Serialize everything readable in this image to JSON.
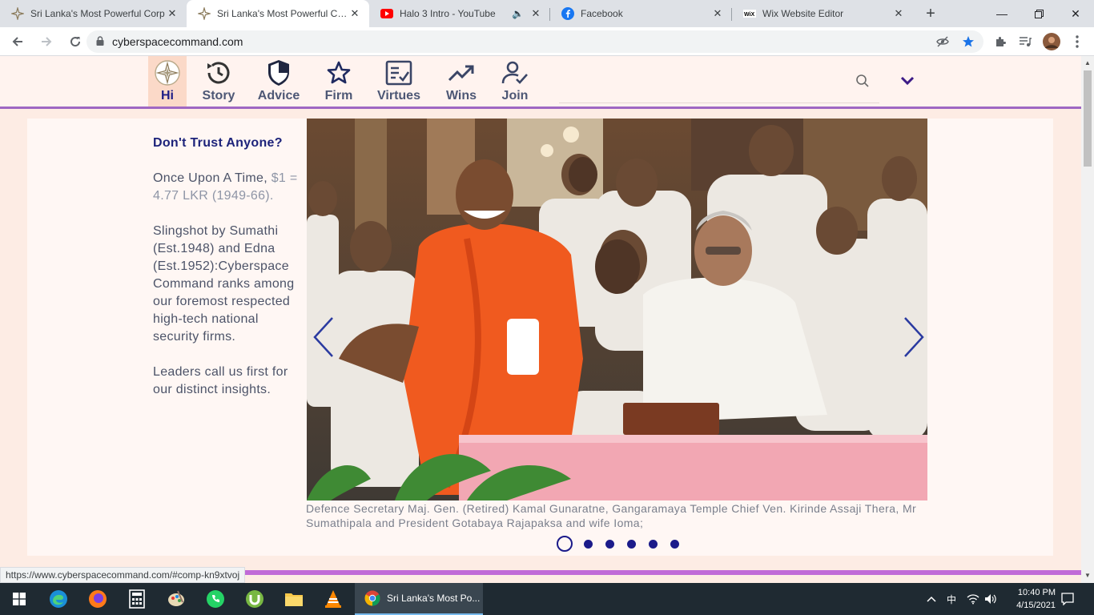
{
  "browser": {
    "tabs": [
      {
        "title": "Sri Lanka's Most Powerful Corp",
        "favicon": "compass-star-icon",
        "active": false
      },
      {
        "title": "Sri Lanka's Most Powerful Corp",
        "favicon": "compass-star-icon",
        "active": true
      },
      {
        "title": "Halo 3 Intro - YouTube",
        "favicon": "youtube-icon",
        "active": false,
        "audio": true
      },
      {
        "title": "Facebook",
        "favicon": "facebook-icon",
        "active": false
      },
      {
        "title": "Wix Website Editor",
        "favicon": "wix-icon",
        "active": false
      }
    ],
    "url": "cyberspacecommand.com",
    "status_url": "https://www.cyberspacecommand.com/#comp-kn9xtvoj"
  },
  "site": {
    "nav": [
      {
        "label": "Hi",
        "icon": "logo-star-icon",
        "active": true
      },
      {
        "label": "Story",
        "icon": "history-icon"
      },
      {
        "label": "Advice",
        "icon": "shield-icon"
      },
      {
        "label": "Firm",
        "icon": "star-outline-icon"
      },
      {
        "label": "Virtues",
        "icon": "checklist-icon"
      },
      {
        "label": "Wins",
        "icon": "trend-up-icon"
      },
      {
        "label": "Join",
        "icon": "user-check-icon"
      }
    ],
    "side": {
      "heading": "Don't Trust Anyone?",
      "para1_text": "Once Upon A Time, ",
      "para1_grey": "$1 = 4.77 LKR (1949-66).",
      "para2": "Slingshot by Sumathi (Est.1948) and Edna (Est.1952):Cyberspace Command ranks among our foremost respected high-tech national security firms.",
      "para3": "Leaders call us first for our distinct insights."
    },
    "slideshow": {
      "caption": "Defence Secretary Maj. Gen. (Retired) Kamal Gunaratne, Gangaramaya Temple Chief Ven. Kirinde Assaji Thera, Mr Sumathipala and President Gotabaya Rajapaksa and wife Ioma;",
      "slide_count": 6,
      "current_slide": 1
    }
  },
  "taskbar": {
    "chrome_title": "Sri Lanka's Most Po...",
    "time": "10:40 PM",
    "date": "4/15/2021",
    "lang": "中"
  },
  "colors": {
    "accent_navy": "#1d1d86",
    "nav_purple": "#9f67c3",
    "bottom_bar": "#c06ad7",
    "page_bg": "#fdece4"
  }
}
